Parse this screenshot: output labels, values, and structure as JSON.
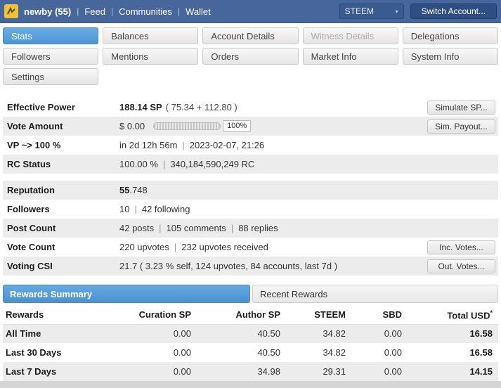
{
  "ui": {
    "sep": "|"
  },
  "topbar": {
    "account_label": "newby (55)",
    "nav": [
      {
        "label": "Feed"
      },
      {
        "label": "Communities"
      },
      {
        "label": "Wallet"
      }
    ],
    "chain_selector": {
      "value": "STEEM"
    },
    "switch_button": "Switch Account..."
  },
  "tabs": {
    "items": [
      {
        "label": "Stats",
        "state": "active"
      },
      {
        "label": "Balances",
        "state": "normal"
      },
      {
        "label": "Account Details",
        "state": "normal"
      },
      {
        "label": "Witness Details",
        "state": "disabled"
      },
      {
        "label": "Delegations",
        "state": "normal"
      },
      {
        "label": "Followers",
        "state": "normal"
      },
      {
        "label": "Mentions",
        "state": "normal"
      },
      {
        "label": "Orders",
        "state": "normal"
      },
      {
        "label": "Market Info",
        "state": "normal"
      },
      {
        "label": "System Info",
        "state": "normal"
      },
      {
        "label": "Settings",
        "state": "normal"
      }
    ]
  },
  "stats": {
    "effective_power": {
      "label": "Effective Power",
      "value_strong": "188.14 SP",
      "value_rest": "( 75.34 + 112.80 )",
      "button": "Simulate SP..."
    },
    "vote_amount": {
      "label": "Vote Amount",
      "value": "$ 0.00",
      "slider_percent": "100%",
      "button": "Sim. Payout..."
    },
    "vp": {
      "label": "VP ~> 100 %",
      "time_left": "in 2d 12h 56m",
      "timestamp": "2023-02-07, 21:26"
    },
    "rc": {
      "label": "RC Status",
      "percent": "100.00 %",
      "value": "340,184,590,249 RC"
    },
    "reputation": {
      "label": "Reputation",
      "value_strong": "55",
      "value_rest": ".748"
    },
    "followers": {
      "label": "Followers",
      "count": "10",
      "following": "42 following"
    },
    "post_count": {
      "label": "Post Count",
      "posts": "42 posts",
      "comments": "105 comments",
      "replies": "88 replies"
    },
    "vote_count": {
      "label": "Vote Count",
      "upvotes": "220 upvotes",
      "received": "232 upvotes received",
      "button": "Inc. Votes..."
    },
    "voting_csi": {
      "label": "Voting CSI",
      "value": "21.7 ( 3.23 % self, 124 upvotes, 84 accounts, last 7d )",
      "button": "Out. Votes..."
    }
  },
  "rewards": {
    "tabs": [
      {
        "label": "Rewards Summary",
        "state": "active"
      },
      {
        "label": "Recent Rewards",
        "state": "normal"
      }
    ],
    "table": {
      "headers": [
        "Rewards",
        "Curation SP",
        "Author SP",
        "STEEM",
        "SBD",
        "Total USD"
      ],
      "footnote_mark": "*",
      "rows": [
        [
          "All Time",
          "0.00",
          "40.50",
          "34.82",
          "0.00",
          "16.58"
        ],
        [
          "Last 30 Days",
          "0.00",
          "40.50",
          "34.82",
          "0.00",
          "16.58"
        ],
        [
          "Last 7 Days",
          "0.00",
          "34.98",
          "29.31",
          "0.00",
          "14.15"
        ]
      ]
    }
  }
}
